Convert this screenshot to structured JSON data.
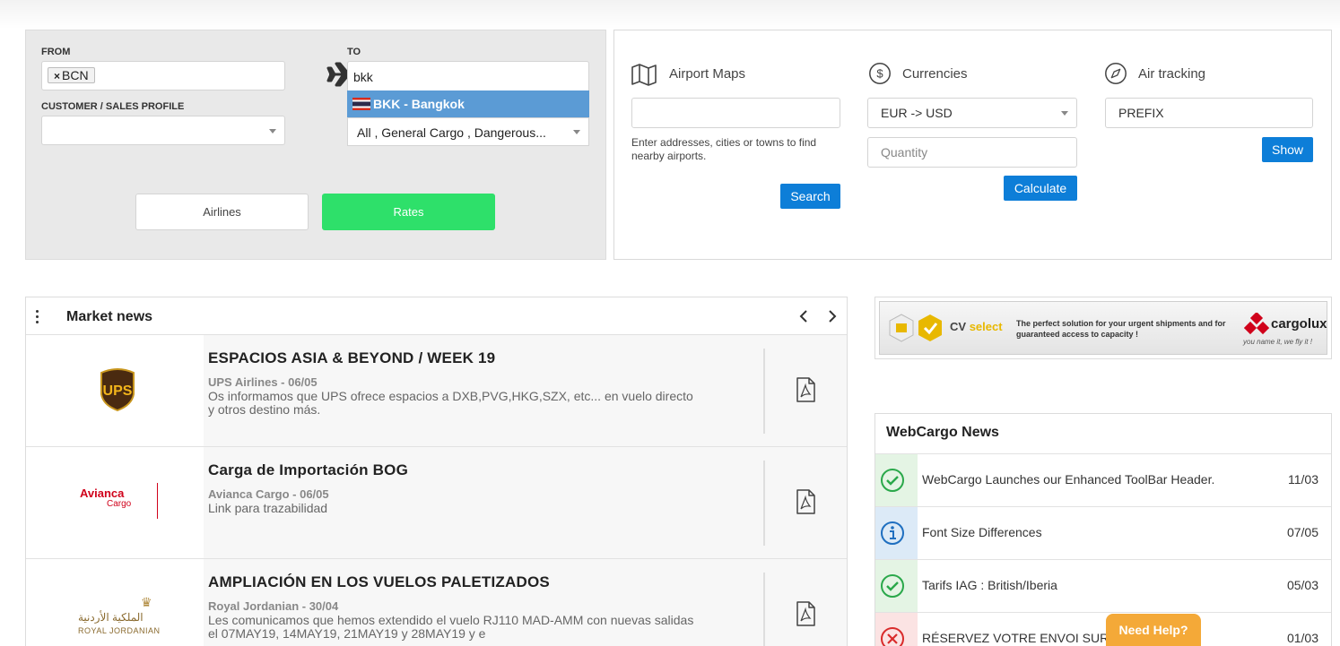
{
  "search": {
    "from_label": "FROM",
    "from_token": "BCN",
    "to_label": "TO",
    "to_value": "bkk",
    "to_option": "BKK - Bangkok",
    "customer_label": "CUSTOMER / SALES PROFILE",
    "customer_value": "",
    "cargo_types": "All , General Cargo , Dangerous...",
    "airlines_button": "Airlines",
    "rates_button": "Rates"
  },
  "tools": {
    "maps": {
      "title": "Airport Maps",
      "input_value": "",
      "hint": "Enter addresses, cities or towns to find nearby airports.",
      "button": "Search"
    },
    "currencies": {
      "title": "Currencies",
      "pair": "EUR -> USD",
      "quantity_placeholder": "Quantity",
      "button": "Calculate"
    },
    "tracking": {
      "title": "Air tracking",
      "prefix_value": "PREFIX",
      "button": "Show"
    }
  },
  "market_news": {
    "title": "Market news",
    "items": [
      {
        "logo": "UPS",
        "title": "ESPACIOS ASIA & BEYOND / WEEK 19",
        "source": "UPS Airlines - 06/05",
        "text": "Os informamos que UPS ofrece espacios a DXB,PVG,HKG,SZX, etc... en vuelo directo y otros destino más."
      },
      {
        "logo": "Avianca",
        "logo_sub": "Cargo",
        "title": "Carga de Importación BOG",
        "source": "Avianca Cargo - 06/05",
        "text": "Link para trazabilidad"
      },
      {
        "logo": "الملكية الأردنية",
        "logo_sub": "ROYAL JORDANIAN",
        "title": "AMPLIACIÓN EN LOS VUELOS PALETIZADOS",
        "source": "Royal Jordanian - 30/04",
        "text": "Les comunicamos que hemos extendido el vuelo RJ110 MAD-AMM con nuevas salidas el 07MAY19, 14MAY19, 21MAY19 y 28MAY19 y e"
      }
    ]
  },
  "banner": {
    "cv": "CV",
    "cv_select": "select",
    "tagline": "The perfect solution for your urgent shipments and for guaranteed access to capacity !",
    "brand": "cargolux",
    "brand_tagline": "you name it, we fly it !"
  },
  "webcargo_news": {
    "title": "WebCargo News",
    "items": [
      {
        "status": "check",
        "text": "WebCargo Launches our Enhanced ToolBar Header.",
        "date": "11/03"
      },
      {
        "status": "info",
        "text": "Font Size Differences",
        "date": "07/05"
      },
      {
        "status": "check",
        "text": "Tarifs IAG : British/Iberia",
        "date": "05/03"
      },
      {
        "status": "error",
        "text": "RÉSERVEZ VOTRE ENVOI SUR",
        "date": "01/03"
      }
    ]
  },
  "help_button": "Need Help?",
  "colors": {
    "rates_green": "#2ee06a",
    "action_blue": "#0d7ed8",
    "option_blue": "#5b9bd5",
    "help_orange": "#f4a938",
    "check_green": "#2aa84a",
    "info_blue": "#1f6fc0",
    "error_red": "#d92b2b"
  }
}
